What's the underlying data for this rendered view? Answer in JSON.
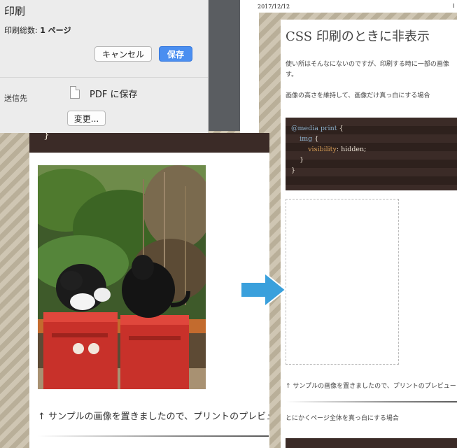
{
  "print_dialog": {
    "title": "印刷",
    "page_count_label": "印刷総数: ",
    "page_count_value": "1 ページ",
    "cancel_label": "キャンセル",
    "save_label": "保存",
    "destination_label": "送信先",
    "destination_value": "PDF に保存",
    "change_label": "変更..."
  },
  "left_preview": {
    "code_closing": "}",
    "caption": "↑ サンプルの画像を置きましたので、プリントのプレビュー"
  },
  "right_preview": {
    "date": "2017/12/12",
    "edge_mark": "I",
    "title": "CSS 印刷のときに非表示",
    "paragraph_1_line_1": "使い所はそんなにないのですが、印刷する時に一部の画像",
    "paragraph_1_line_2": "す。",
    "paragraph_2": "画像の高さを維持して、画像だけ真っ白にする場合",
    "code": {
      "line_1_kw": "@media print",
      "line_1_brace": " {",
      "line_2_kw": "img",
      "line_2_brace": " {",
      "line_3_prop": "visibility",
      "line_3_val": ": hidden;",
      "line_4": "}",
      "line_5": "}"
    },
    "caption": "↑ サンプルの画像を置きましたので、プリントのプレビュー",
    "paragraph_3": "とにかくページ全体を真っ白にする場合"
  },
  "colors": {
    "save_button": "#4a8ef0",
    "arrow": "#3aa0dc",
    "code_background": "#3b2b27"
  },
  "icons": {
    "arrow": "right-arrow-icon",
    "pdf": "document-icon"
  }
}
